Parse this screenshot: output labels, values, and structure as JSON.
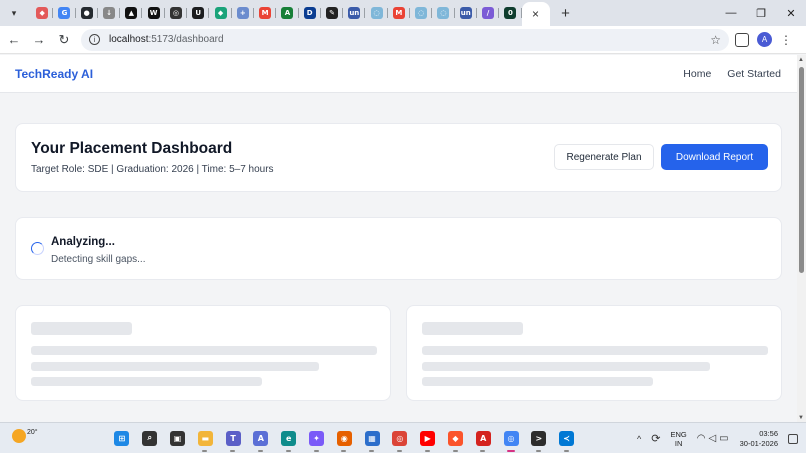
{
  "browser": {
    "tabs": [
      {
        "icon": "app-grid-icon",
        "color": "#e35a5a",
        "glyph": "◆"
      },
      {
        "icon": "google-icon",
        "color": "#4285f4",
        "glyph": "G"
      },
      {
        "icon": "github-icon",
        "color": "#24292f",
        "glyph": "●"
      },
      {
        "icon": "arrow-icon",
        "color": "#888888",
        "glyph": "↓"
      },
      {
        "icon": "vercel-icon",
        "color": "#111111",
        "glyph": "▲"
      },
      {
        "icon": "wv-icon",
        "color": "#111111",
        "glyph": "W"
      },
      {
        "icon": "openai-icon",
        "color": "#333333",
        "glyph": "◎"
      },
      {
        "icon": "udemy-icon",
        "color": "#1c1d1f",
        "glyph": "U"
      },
      {
        "icon": "diamond-icon",
        "color": "#1aa37a",
        "glyph": "◆"
      },
      {
        "icon": "plus-icon",
        "color": "#6b8cce",
        "glyph": "+"
      },
      {
        "icon": "gmail-icon",
        "color": "#ea4335",
        "glyph": "M"
      },
      {
        "icon": "sheets-icon",
        "color": "#188038",
        "glyph": "A"
      },
      {
        "icon": "d-icon",
        "color": "#0b3d91",
        "glyph": "D"
      },
      {
        "icon": "pen-icon",
        "color": "#222222",
        "glyph": "✎"
      },
      {
        "icon": "unstop-icon",
        "color": "#3b5ba9",
        "glyph": "un"
      },
      {
        "icon": "globe-icon",
        "color": "#7fb7d9",
        "glyph": "◌"
      },
      {
        "icon": "gmail-icon",
        "color": "#ea4335",
        "glyph": "M"
      },
      {
        "icon": "globe-icon",
        "color": "#7fb7d9",
        "glyph": "◌"
      },
      {
        "icon": "globe-icon",
        "color": "#7fb7d9",
        "glyph": "◌"
      },
      {
        "icon": "unstop-icon",
        "color": "#3b5ba9",
        "glyph": "un"
      },
      {
        "icon": "slash-icon",
        "color": "#7b5bd6",
        "glyph": "/"
      },
      {
        "icon": "dot-icon",
        "color": "#0f3d2e",
        "glyph": "0"
      }
    ],
    "active_tab_close": "×",
    "new_tab": "+",
    "window_controls": {
      "minimize": "—",
      "restore": "❐",
      "close": "✕"
    },
    "menu_glyph": "▾",
    "nav": {
      "back": "←",
      "forward": "→",
      "reload": "↻"
    },
    "url_host": "localhost",
    "url_path": ":5173/dashboard",
    "profile_initial": "A",
    "star": "☆",
    "kebab": "⋮"
  },
  "navbar": {
    "brand": "TechReady AI",
    "links": [
      "Home",
      "Get Started"
    ]
  },
  "header": {
    "title": "Your Placement Dashboard",
    "subtitle": "Target Role: SDE | Graduation: 2026 | Time: 5–7 hours",
    "regenerate_label": "Regenerate Plan",
    "download_label": "Download Report"
  },
  "status": {
    "title": "Analyzing...",
    "message": "Detecting skill gaps..."
  },
  "taskbar": {
    "temperature": "20°",
    "apps": [
      {
        "icon": "windows-start-icon",
        "color": "#1e88e5",
        "glyph": "⊞"
      },
      {
        "icon": "search-icon",
        "color": "#333333",
        "glyph": "⌕"
      },
      {
        "icon": "task-view-icon",
        "color": "#333333",
        "glyph": "▣"
      },
      {
        "icon": "file-explorer-icon",
        "color": "#f2b53a",
        "glyph": "▬"
      },
      {
        "icon": "teams-icon",
        "color": "#5b5fc7",
        "glyph": "T"
      },
      {
        "icon": "copilot-icon",
        "color": "#5b6fd6",
        "glyph": "A"
      },
      {
        "icon": "edge-icon",
        "color": "#0f8c8c",
        "glyph": "e"
      },
      {
        "icon": "copilot-app-icon",
        "color": "#7a5af8",
        "glyph": "✦"
      },
      {
        "icon": "firefox-icon",
        "color": "#e66000",
        "glyph": "◉"
      },
      {
        "icon": "store-icon",
        "color": "#2c6ecb",
        "glyph": "▦"
      },
      {
        "icon": "chrome-icon",
        "color": "#db4437",
        "glyph": "◎"
      },
      {
        "icon": "youtube-icon",
        "color": "#ff0000",
        "glyph": "▶"
      },
      {
        "icon": "brave-icon",
        "color": "#fb542b",
        "glyph": "◆"
      },
      {
        "icon": "acrobat-icon",
        "color": "#d4231f",
        "glyph": "A"
      },
      {
        "icon": "chrome-profile-icon",
        "color": "#4285f4",
        "glyph": "◎"
      },
      {
        "icon": "terminal-icon",
        "color": "#2d2d2d",
        "glyph": ">"
      },
      {
        "icon": "vscode-icon",
        "color": "#0078d4",
        "glyph": "≺"
      }
    ],
    "active_app_index": 14,
    "lang_top": "ENG",
    "lang_bottom": "IN",
    "time": "03:56",
    "date": "30-01-2026"
  },
  "colors": {
    "brand": "#2b5fd9",
    "primary_button": "#2563eb",
    "skeleton": "#e5e7eb"
  }
}
